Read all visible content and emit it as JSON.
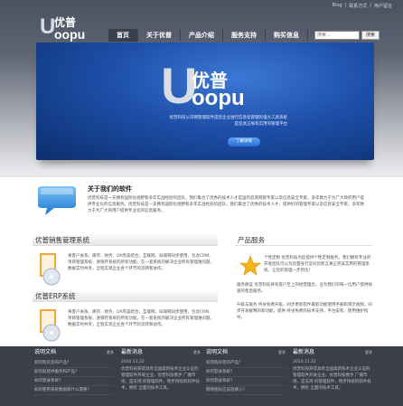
{
  "top_links": [
    "Blog",
    "|",
    "联系方式",
    "|",
    "用户留言"
  ],
  "logo": {
    "letter": "U",
    "cn": "优普",
    "en": "oopu"
  },
  "nav": [
    "首页",
    "关于优普",
    "产品介绍",
    "服务支持",
    "购买信息"
  ],
  "search": {
    "placeholder": "搜索...",
    "button": "搜索"
  },
  "banner": {
    "logo_letter": "U",
    "logo_cn": "优普",
    "logo_en": "oopu",
    "text": [
      "优普科技公司网管理软件是您企业进行信息化管理的强大工具系统",
      "是您具正规有实用的管理平台"
    ],
    "button": "了解详情"
  },
  "intro": {
    "title": "关于我们的软件",
    "text": "优普科技是一支拥有国际化视野和多年实战经验的团队，我们集合了优秀的技术人才是国内首席网管专家以及信息安全专家，多年致力于为广大政府用户提供专业化的信息服务。优普科技是一支拥有国际化视野和多年实战经验的团队，我们集合了优秀的技术人才，提供好的管理专家以及信息安全专家，多年致力于为广大商用户提供专业化的信息服务。"
  },
  "products": [
    {
      "title": "优普销售管理系统",
      "text": "将客户关系、库存、财务、OA完美结合，互联网、局域网同步使用。包含CRM、项目管理系统、进销存系统的所有功能。在一套系统内解决企业所有管理难问题，数据实时共享，全程实现企业各个环节的流转和协作。"
    },
    {
      "title": "优普ERP系统",
      "text": "将客户关系、库存、财务、OA完美结合，互联网、局域网同步使用。包含CRM、项目管理系统、进销存系统的所有功能。在一套系统内解决企业所有管理难问题，数据实时共享，全程实现企业各个环节的流转和协作。"
    }
  ],
  "service": {
    "title": "产品服务",
    "text1": "个性定制 优普科技为您提供个性定制服务，我们拥有专业的开发团队可以为您量身打造对您而言真正完美实用的管理系统，让您的管理一步到位！",
    "text2": "服务保证 优普科技将有客户至上的经营理念，业为我们的每一位用户提供快速的售后服务。",
    "text3": "升级与服务 终身免费升级，同步更新软件最新功能使用手册和演示视频，同步开发解释的新功能，提供 终身免费的技术支持，平台安装、使用维护指导。"
  },
  "footer": {
    "more": "更多",
    "col1": {
      "title": "说明文档",
      "items": [
        "如何购买您的产品？",
        "如何就提供服务和产品？",
        "如何登录系统？",
        "如何使用系统数据库什么需要？"
      ]
    },
    "col2": {
      "title": "最新消息",
      "date": "2010.11.22",
      "text": "优普科技获得具有全国高新技术企业认证的管理软件开发企业。优普科技携手 广播市场，是支持 的管理软件，稳步持续的软件技术，拥有 全面的技术工具。"
    },
    "col3": {
      "title": "说明文档",
      "items": [
        "如何购买您的产品？",
        "如何登录系统？",
        "如何登录系统？",
        "网络图标应该放哪儿？"
      ]
    },
    "col4": {
      "title": "最新消息",
      "date": "2010.11.22",
      "text": "优普科技获得具有全国高新技术企业认证的管理软件开发企业。优普科技携手 广播市场，是支持 的管理软件，稳步持续的软件技术，拥有 全面的技术工具。"
    }
  }
}
